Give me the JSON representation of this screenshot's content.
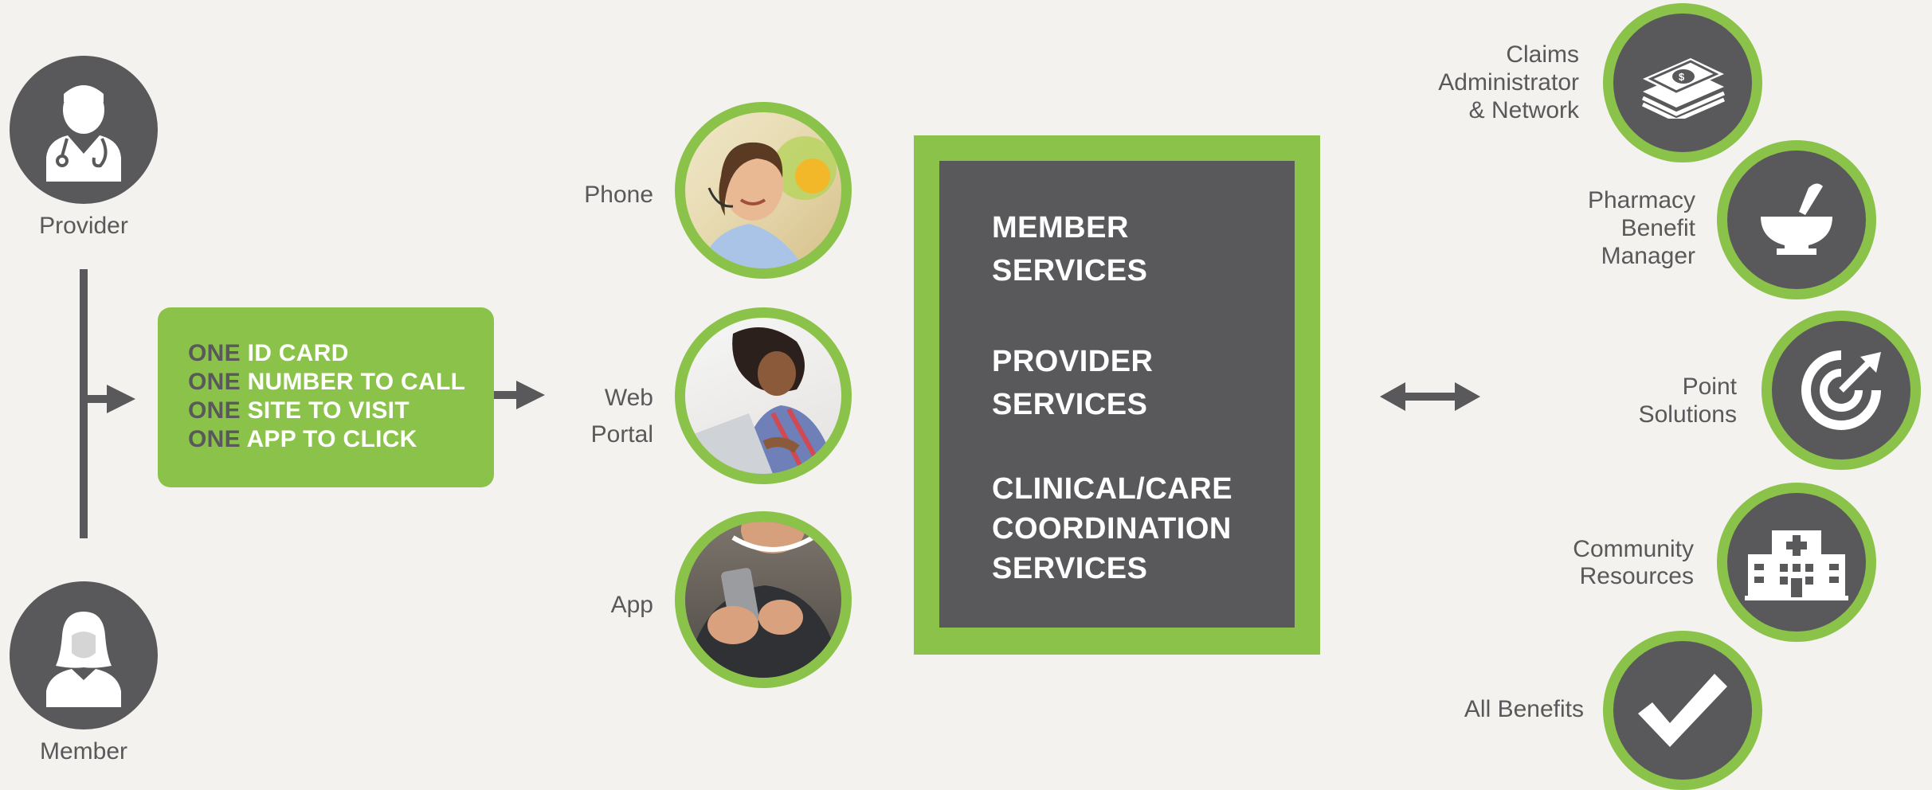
{
  "left": {
    "provider_label": "Provider",
    "member_label": "Member"
  },
  "card": {
    "lines": [
      {
        "prefix": "ONE",
        "text": "ID CARD"
      },
      {
        "prefix": "ONE",
        "text": "NUMBER TO CALL"
      },
      {
        "prefix": "ONE",
        "text": "SITE TO VISIT"
      },
      {
        "prefix": "ONE",
        "text": "APP TO CLICK"
      }
    ]
  },
  "channels": {
    "phone": "Phone",
    "web_line1": "Web",
    "web_line2": "Portal",
    "app": "App"
  },
  "services": {
    "member_1": "MEMBER",
    "member_2": "SERVICES",
    "provider_1": "PROVIDER",
    "provider_2": "SERVICES",
    "clinical_1": "CLINICAL/CARE",
    "clinical_2": "COORDINATION",
    "clinical_3": "SERVICES"
  },
  "partners": {
    "claims_1": "Claims",
    "claims_2": "Administrator",
    "claims_3": "& Network",
    "pharmacy_1": "Pharmacy",
    "pharmacy_2": "Benefit",
    "pharmacy_3": "Manager",
    "point_1": "Point",
    "point_2": "Solutions",
    "community_1": "Community",
    "community_2": "Resources",
    "all_benefits": "All Benefits"
  },
  "icons": {
    "provider": "doctor-icon",
    "member": "member-icon",
    "claims": "money-stack-icon",
    "pharmacy": "mortar-pestle-icon",
    "point": "target-arrow-icon",
    "community": "hospital-icon",
    "benefits": "checkmark-icon"
  },
  "colors": {
    "green": "#8bc34a",
    "gray": "#59585a",
    "background": "#f3f2ee"
  }
}
